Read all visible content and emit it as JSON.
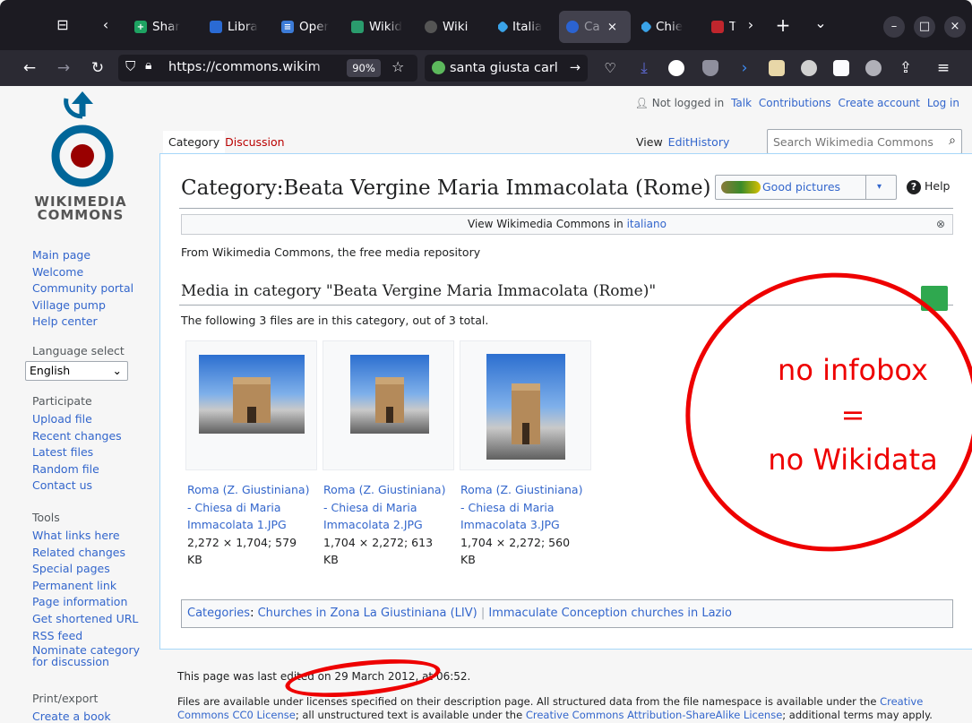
{
  "browser": {
    "tabs": [
      {
        "label": "Shar",
        "color": "#1ea362"
      },
      {
        "label": "Libra",
        "color": "#2a6ad3"
      },
      {
        "label": "Oper",
        "color": "#3c7bd7"
      },
      {
        "label": "Wikid",
        "color": "#2a9c6d"
      },
      {
        "label": "Wiki",
        "color": "#555555"
      },
      {
        "label": "Italia",
        "color": "#3aa3e8"
      },
      {
        "label": "Ca",
        "color": "#2b63d1"
      },
      {
        "label": "Chie",
        "color": "#3aa3e8"
      },
      {
        "label": "T",
        "color": "#c0262d"
      }
    ],
    "url": "https://commons.wikim",
    "zoom": "90%",
    "search": "santa giusta carl",
    "new_tab": "+",
    "tab_overflow": "⌄"
  },
  "top_links": {
    "not_logged_in": "Not logged in",
    "talk": "Talk",
    "contributions": "Contributions",
    "create_account": "Create account",
    "log_in": "Log in"
  },
  "logo": {
    "line1": "WIKIMEDIA",
    "line2": "COMMONS"
  },
  "sidebar": {
    "nav": [
      "Main page",
      "Welcome",
      "Community portal",
      "Village pump",
      "Help center"
    ],
    "language_header": "Language select",
    "language_value": "English",
    "participate_header": "Participate",
    "participate": [
      "Upload file",
      "Recent changes",
      "Latest files",
      "Random file",
      "Contact us"
    ],
    "tools_header": "Tools",
    "tools": [
      "What links here",
      "Related changes",
      "Special pages",
      "Permanent link",
      "Page information",
      "Get shortened URL",
      "RSS feed",
      "Nominate category",
      "for discussion"
    ],
    "print_header": "Print/export",
    "print": [
      "Create a book"
    ]
  },
  "tabs": {
    "category": "Category",
    "discussion": "Discussion",
    "view": "View",
    "edit": "Edit",
    "history": "History"
  },
  "search": {
    "placeholder": "Search Wikimedia Commons"
  },
  "title": "Category:Beata Vergine Maria Immacolata (Rome)",
  "good_pictures": "Good pictures",
  "help": "Help",
  "banner": {
    "text": "View Wikimedia Commons in ",
    "link": "italiano"
  },
  "from_line": "From Wikimedia Commons, the free media repository",
  "media_heading": "Media in category \"Beata Vergine Maria Immacolata (Rome)\"",
  "count_line": "The following 3 files are in this category, out of 3 total.",
  "files": [
    {
      "name1": "Roma (Z. Giustiniana)",
      "name2": "- Chiesa di Maria",
      "name3": "Immacolata 1.JPG",
      "meta1": "2,272 × 1,704; 579",
      "meta2": "KB"
    },
    {
      "name1": "Roma (Z. Giustiniana)",
      "name2": "- Chiesa di Maria",
      "name3": "Immacolata 2.JPG",
      "meta1": "1,704 × 2,272; 613",
      "meta2": "KB"
    },
    {
      "name1": "Roma (Z. Giustiniana)",
      "name2": "- Chiesa di Maria",
      "name3": "Immacolata 3.JPG",
      "meta1": "1,704 × 2,272; 560",
      "meta2": "KB"
    }
  ],
  "categories": {
    "label": "Categories",
    "items": [
      "Churches in Zona La Giustiniana (LIV)",
      "Immaculate Conception churches in Lazio"
    ]
  },
  "footer": {
    "last_edited": "This page was last edited on 29 March 2012, at 06:52.",
    "license_a": "Files are available under licenses specified on their description page. All structured data from the file namespace is available under the ",
    "license_link1": "Creative Commons CC0 License",
    "license_b": "; all unstructured text is available under the ",
    "license_link2": "Creative Commons Attribution-ShareAlike License",
    "license_c": "; additional terms may apply. By"
  },
  "annotation": {
    "line1": "no infobox",
    "line2": "=",
    "line3": "no Wikidata",
    "color": "#ee0000"
  },
  "colors": {
    "link": "#3366cc",
    "border": "#a7d7f9",
    "accent": "#36c"
  }
}
